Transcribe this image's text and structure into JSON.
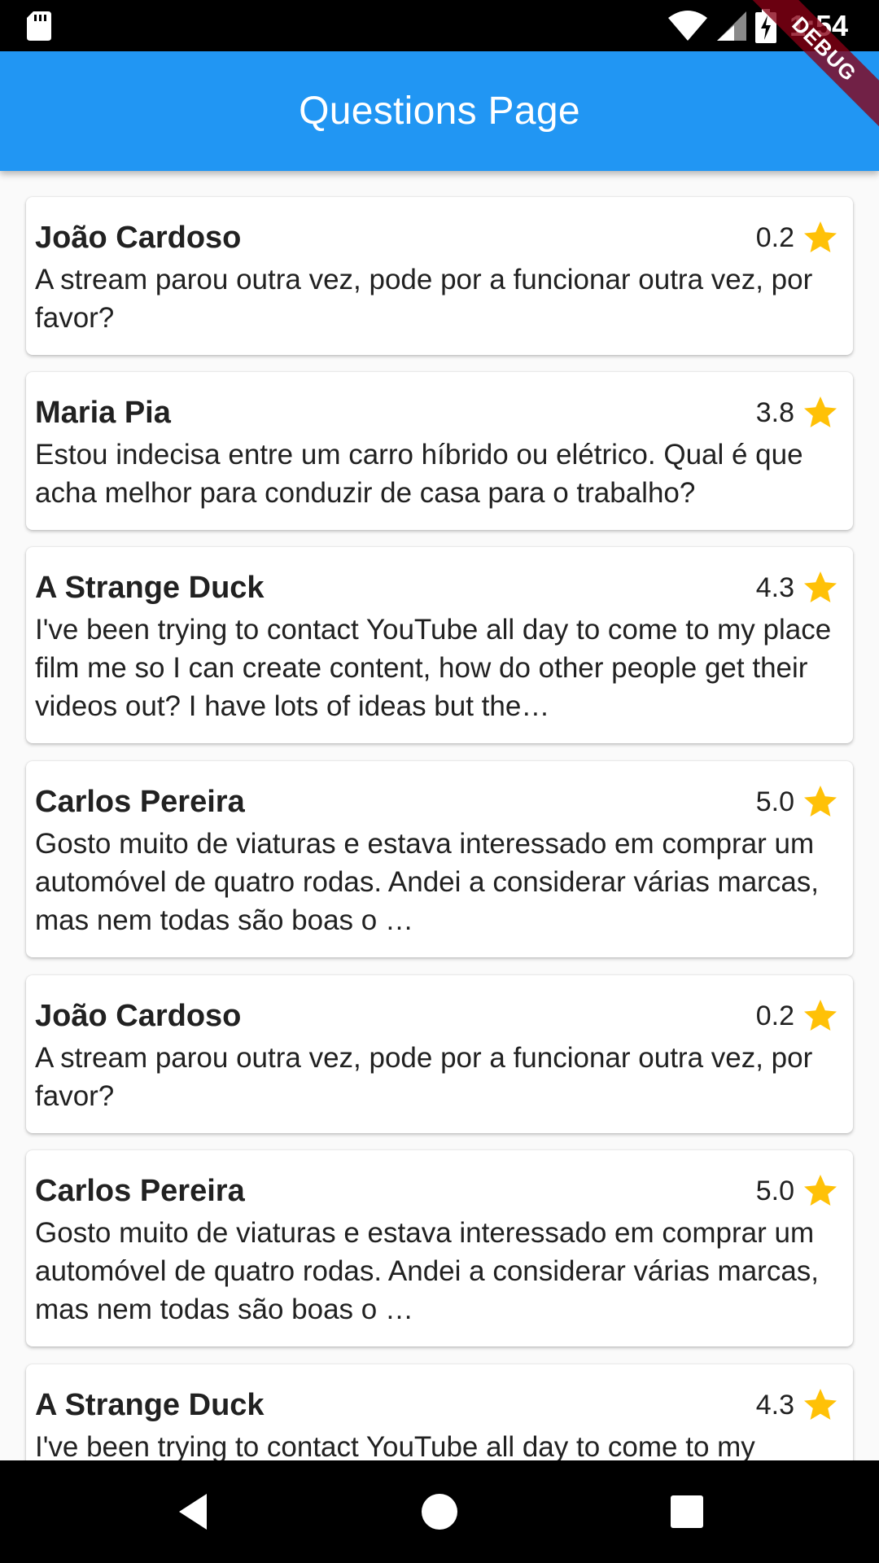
{
  "status_bar": {
    "time": "1:54",
    "icons": [
      "sd-card-icon",
      "wifi-icon",
      "cell-signal-icon",
      "battery-charging-icon"
    ]
  },
  "app_bar": {
    "title": "Questions Page",
    "color": "#2196f3"
  },
  "debug_banner": "DEBUG",
  "questions": [
    {
      "author": "João Cardoso",
      "rating": "0.2",
      "text": "A stream parou outra vez, pode por a funcionar outra vez, por favor?"
    },
    {
      "author": "Maria Pia",
      "rating": "3.8",
      "text": "Estou indecisa entre um carro híbrido ou elétrico. Qual é que acha melhor para conduzir de casa para o trabalho?"
    },
    {
      "author": "A Strange Duck",
      "rating": "4.3",
      "text": "I've been trying to contact YouTube all day to come to my place film me so I can create content, how do other people get their videos out? I have lots of ideas but the…"
    },
    {
      "author": "Carlos Pereira",
      "rating": "5.0",
      "text": "Gosto muito de viaturas e estava interessado em comprar um automóvel de quatro rodas. Andei a considerar várias marcas, mas nem todas são boas o …"
    },
    {
      "author": "João Cardoso",
      "rating": "0.2",
      "text": "A stream parou outra vez, pode por a funcionar outra vez, por favor?"
    },
    {
      "author": "Carlos Pereira",
      "rating": "5.0",
      "text": "Gosto muito de viaturas e estava interessado em comprar um automóvel de quatro rodas. Andei a considerar várias marcas, mas nem todas são boas o …"
    },
    {
      "author": "A Strange Duck",
      "rating": "4.3",
      "text": "I've been trying to contact YouTube all day to come to my"
    }
  ],
  "colors": {
    "star": "#ffc107",
    "text": "#212121"
  },
  "nav_bar": {
    "icons": [
      "back-icon",
      "home-icon",
      "recents-icon"
    ]
  }
}
